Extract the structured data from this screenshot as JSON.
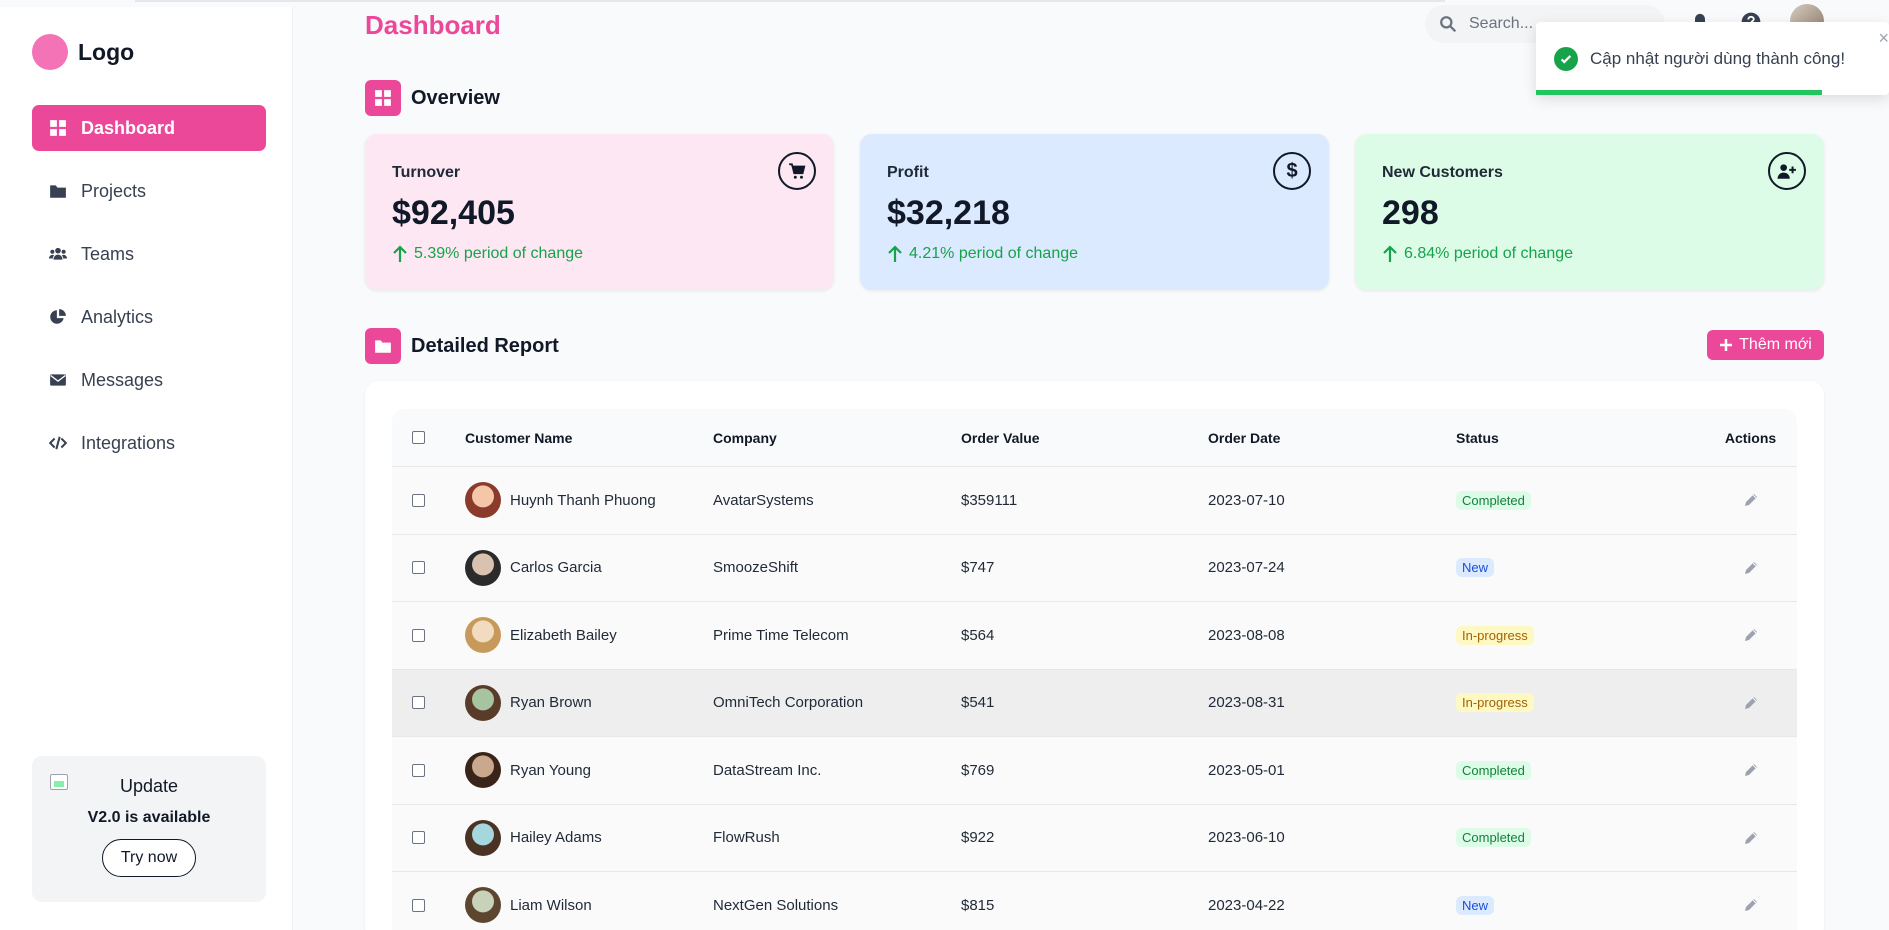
{
  "sidebar": {
    "logo": "Logo",
    "items": [
      {
        "label": "Dashboard",
        "icon": "grid-icon",
        "active": true
      },
      {
        "label": "Projects",
        "icon": "folder-icon"
      },
      {
        "label": "Teams",
        "icon": "users-icon"
      },
      {
        "label": "Analytics",
        "icon": "pie-chart-icon"
      },
      {
        "label": "Messages",
        "icon": "envelope-icon"
      },
      {
        "label": "Integrations",
        "icon": "code-icon"
      }
    ],
    "update": {
      "title": "Update",
      "subtitle": "V2.0 is available",
      "button": "Try now"
    }
  },
  "header": {
    "title": "Dashboard",
    "search_placeholder": "Search..."
  },
  "toast": {
    "message": "Cập nhật người dùng thành công!",
    "type": "success",
    "progress": 0.81
  },
  "overview": {
    "title": "Overview",
    "cards": [
      {
        "label": "Turnover",
        "value": "$92,405",
        "change": "5.39% period of change",
        "icon": "cart-icon",
        "bg": "#fce7f3"
      },
      {
        "label": "Profit",
        "value": "$32,218",
        "change": "4.21% period of change",
        "icon": "dollar-icon",
        "bg": "#dbeafe"
      },
      {
        "label": "New Customers",
        "value": "298",
        "change": "6.84% period of change",
        "icon": "user-plus-icon",
        "bg": "#dcfce7"
      }
    ]
  },
  "report": {
    "title": "Detailed Report",
    "add_button": "Thêm mới",
    "columns": [
      "Customer Name",
      "Company",
      "Order Value",
      "Order Date",
      "Status",
      "Actions"
    ],
    "rows": [
      {
        "name": "Huynh Thanh Phuong",
        "company": "AvatarSystems",
        "value": "$359111",
        "date": "2023-07-10",
        "status": "Completed"
      },
      {
        "name": "Carlos Garcia",
        "company": "SmoozeShift",
        "value": "$747",
        "date": "2023-07-24",
        "status": "New"
      },
      {
        "name": "Elizabeth Bailey",
        "company": "Prime Time Telecom",
        "value": "$564",
        "date": "2023-08-08",
        "status": "In-progress"
      },
      {
        "name": "Ryan Brown",
        "company": "OmniTech Corporation",
        "value": "$541",
        "date": "2023-08-31",
        "status": "In-progress"
      },
      {
        "name": "Ryan Young",
        "company": "DataStream Inc.",
        "value": "$769",
        "date": "2023-05-01",
        "status": "Completed"
      },
      {
        "name": "Hailey Adams",
        "company": "FlowRush",
        "value": "$922",
        "date": "2023-06-10",
        "status": "Completed"
      },
      {
        "name": "Liam Wilson",
        "company": "NextGen Solutions",
        "value": "$815",
        "date": "2023-04-22",
        "status": "New"
      }
    ]
  },
  "colors": {
    "accent": "#ec4899",
    "success": "#16a34a"
  }
}
